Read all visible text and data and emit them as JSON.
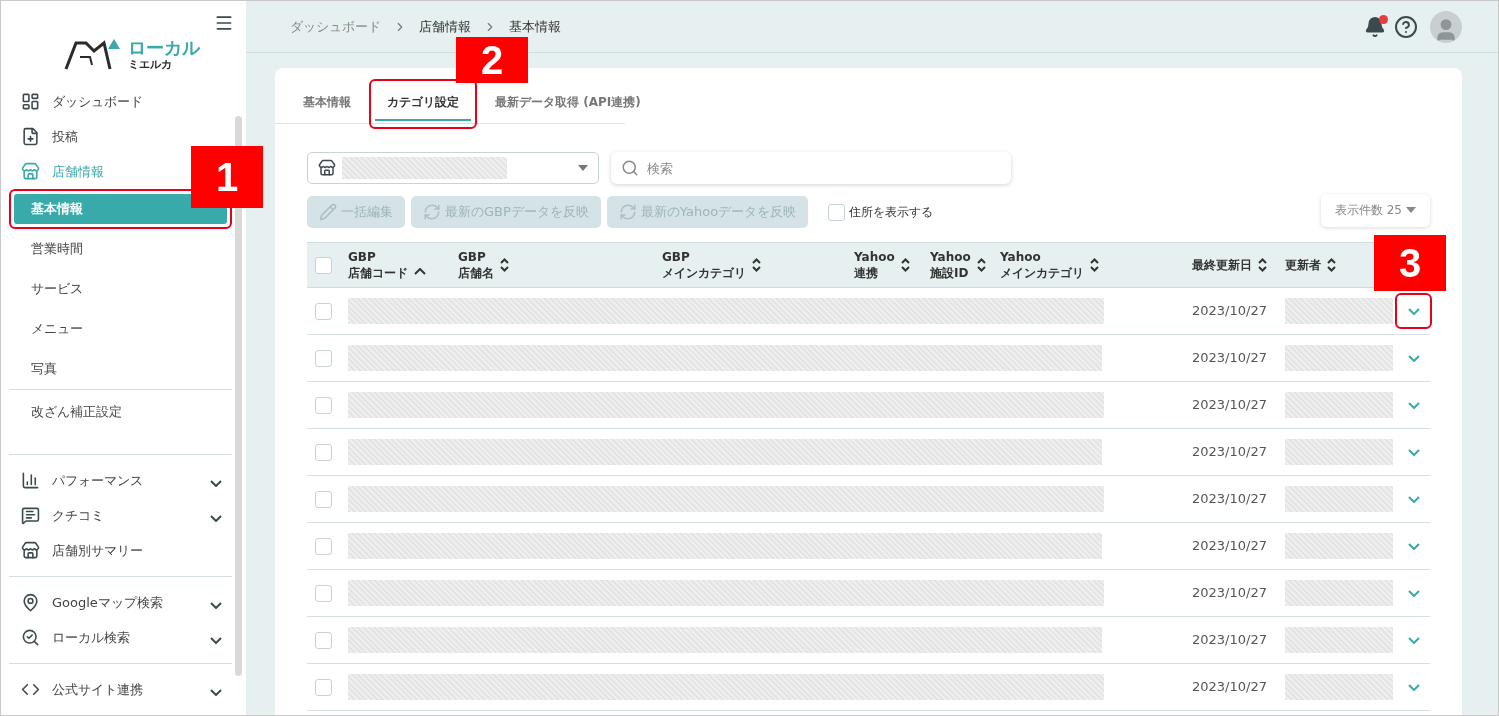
{
  "logo": {
    "top": "ローカル",
    "bottom": "ミエルカ"
  },
  "sidebar": {
    "groups": [
      {
        "items": [
          {
            "label": "ダッシュボード",
            "kind": "main",
            "selected": false
          },
          {
            "label": "投稿",
            "kind": "main",
            "selected": false
          },
          {
            "label": "店舗情報",
            "kind": "main",
            "selected": true
          },
          {
            "label": "基本情報",
            "kind": "sub",
            "selected": true,
            "highlighted": true
          },
          {
            "label": "営業時間",
            "kind": "sub",
            "selected": false,
            "highlighted": false
          },
          {
            "label": "サービス",
            "kind": "sub",
            "selected": false,
            "highlighted": false
          },
          {
            "label": "メニュー",
            "kind": "sub",
            "selected": false,
            "highlighted": false
          },
          {
            "label": "写真",
            "kind": "sub",
            "selected": false,
            "highlighted": false
          }
        ]
      },
      {
        "items": [
          {
            "label": "改ざん補正設定",
            "kind": "sub",
            "selected": false,
            "highlighted": false
          }
        ]
      },
      {
        "items": [
          {
            "label": "パフォーマンス",
            "kind": "main",
            "selected": false,
            "expanded": false
          },
          {
            "label": "クチコミ",
            "kind": "main",
            "selected": false,
            "expanded": false
          },
          {
            "label": "店舗別サマリー",
            "kind": "main",
            "selected": false
          }
        ]
      },
      {
        "items": [
          {
            "label": "Googleマップ検索",
            "kind": "main",
            "selected": false,
            "expanded": false
          },
          {
            "label": "ローカル検索",
            "kind": "main",
            "selected": false,
            "expanded": false
          }
        ]
      },
      {
        "items": [
          {
            "label": "公式サイト連携",
            "kind": "main",
            "selected": false,
            "expanded": false
          }
        ]
      }
    ]
  },
  "breadcrumb": [
    "ダッシュボード",
    "店舗情報",
    "基本情報"
  ],
  "header": {
    "notification": true
  },
  "tabs": [
    {
      "label": "基本情報",
      "selected": false,
      "highlighted": false
    },
    {
      "label": "カテゴリ設定",
      "selected": true,
      "highlighted": true
    },
    {
      "label": "最新データ取得 (API連携)",
      "selected": false,
      "highlighted": false
    }
  ],
  "search": {
    "placeholder": "検索"
  },
  "actions": [
    {
      "label": "一括編集",
      "disabled": true
    },
    {
      "label": "最新のGBPデータを反映",
      "disabled": true
    },
    {
      "label": "最新のYahooデータを反映",
      "disabled": true
    }
  ],
  "show_address": {
    "label": "住所を表示する",
    "checked": false
  },
  "per_page": {
    "label": "表示件数",
    "value": "25"
  },
  "table": {
    "all_checked": false,
    "columns": [
      {
        "top": "GBP",
        "bottom": "店舗コード",
        "sorted": true
      },
      {
        "top": "GBP",
        "bottom": "店舗名",
        "sorted": false
      },
      {
        "top": "GBP",
        "bottom": "メインカテゴリ",
        "sorted": false
      },
      {
        "top": "Yahoo",
        "bottom": "連携",
        "sorted": false
      },
      {
        "top": "Yahoo",
        "bottom": "施設ID",
        "sorted": false
      },
      {
        "top": "Yahoo",
        "bottom": "メインカテゴリ",
        "sorted": false
      },
      {
        "bottom": "最終更新日",
        "sorted": false
      },
      {
        "bottom": "更新者",
        "sorted": false
      }
    ],
    "rows": [
      {
        "updated": "2023/10/27",
        "checked": false,
        "expanded": false,
        "highlighted": true
      },
      {
        "updated": "2023/10/27",
        "checked": false,
        "expanded": false,
        "highlighted": false
      },
      {
        "updated": "2023/10/27",
        "checked": false,
        "expanded": false,
        "highlighted": false
      },
      {
        "updated": "2023/10/27",
        "checked": false,
        "expanded": false,
        "highlighted": false
      },
      {
        "updated": "2023/10/27",
        "checked": false,
        "expanded": false,
        "highlighted": false
      },
      {
        "updated": "2023/10/27",
        "checked": false,
        "expanded": false,
        "highlighted": false
      },
      {
        "updated": "2023/10/27",
        "checked": false,
        "expanded": false,
        "highlighted": false
      },
      {
        "updated": "2023/10/27",
        "checked": false,
        "expanded": false,
        "highlighted": false
      },
      {
        "updated": "2023/10/27",
        "checked": false,
        "expanded": false,
        "highlighted": false
      }
    ]
  },
  "callouts": [
    "1",
    "2",
    "3"
  ]
}
